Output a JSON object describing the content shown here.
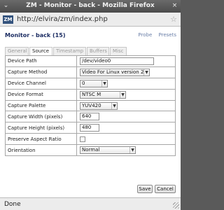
{
  "window": {
    "title": "ZM - Monitor - back - Mozilla Firefox",
    "minimize_glyph": "⌄",
    "close_glyph": "×",
    "status": "Done"
  },
  "address_bar": {
    "favicon_text": "ZM",
    "url": "http://elvira/zm/index.php",
    "star_glyph": "☆"
  },
  "page": {
    "title": "Monitor - back (15)",
    "links": [
      "Probe",
      "Presets"
    ]
  },
  "tabs": [
    {
      "label": "General",
      "active": false
    },
    {
      "label": "Source",
      "active": true
    },
    {
      "label": "Timestamp",
      "active": false
    },
    {
      "label": "Buffers",
      "active": false
    },
    {
      "label": "Misc",
      "active": false
    }
  ],
  "form": {
    "rows": [
      {
        "label": "Device Path",
        "value": "/dev/video0"
      },
      {
        "label": "Capture Method",
        "value": "Video For Linux version 2"
      },
      {
        "label": "Device Channel",
        "value": "0"
      },
      {
        "label": "Device Format",
        "value": "NTSC M"
      },
      {
        "label": "Capture Palette",
        "value": "YUV420"
      },
      {
        "label": "Capture Width (pixels)",
        "value": "640"
      },
      {
        "label": "Capture Height (pixels)",
        "value": "480"
      },
      {
        "label": "Preserve Aspect Ratio",
        "checked": false
      },
      {
        "label": "Orientation",
        "value": "Normal"
      }
    ]
  },
  "buttons": {
    "save": "Save",
    "cancel": "Cancel"
  }
}
